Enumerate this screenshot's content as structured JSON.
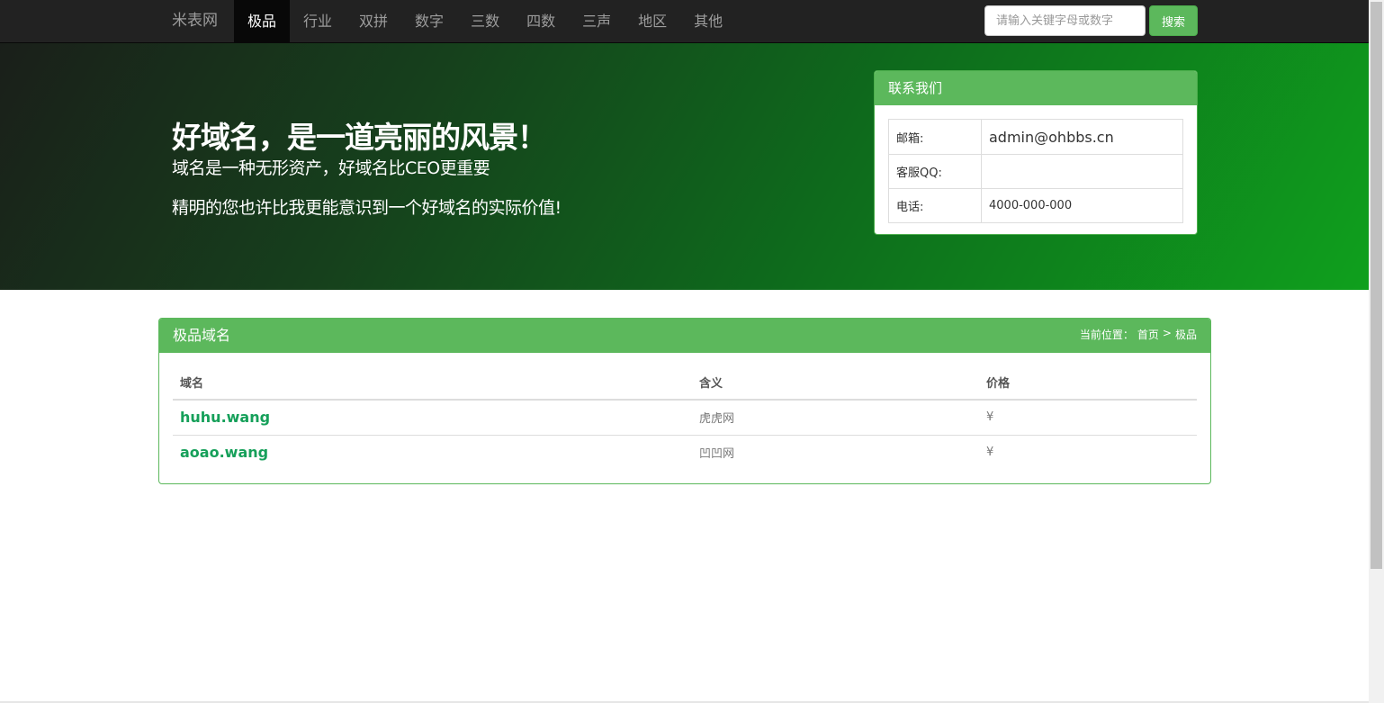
{
  "navbar": {
    "brand": "米表网",
    "items": [
      {
        "label": "极品",
        "active": true
      },
      {
        "label": "行业",
        "active": false
      },
      {
        "label": "双拼",
        "active": false
      },
      {
        "label": "数字",
        "active": false
      },
      {
        "label": "三数",
        "active": false
      },
      {
        "label": "四数",
        "active": false
      },
      {
        "label": "三声",
        "active": false
      },
      {
        "label": "地区",
        "active": false
      },
      {
        "label": "其他",
        "active": false
      }
    ],
    "search_placeholder": "请输入关键字母或数字",
    "search_value": "",
    "search_button": "搜索"
  },
  "hero": {
    "title": "好域名，是一道亮丽的风景！",
    "subtitle": "域名是一种无形资产，好域名比CEO更重要",
    "subtitle2": "精明的您也许比我更能意识到一个好域名的实际价值!"
  },
  "contact": {
    "title": "联系我们",
    "rows": [
      {
        "key": "邮箱:",
        "value": "admin@ohbbs.cn"
      },
      {
        "key": "客服QQ:",
        "value": ""
      },
      {
        "key": "电话:",
        "value": "4000-000-000"
      }
    ]
  },
  "domains": {
    "title": "极品域名",
    "breadcrumb": {
      "prefix": "当前位置：",
      "home": "首页",
      "sep": ">",
      "current": "极品"
    },
    "columns": [
      "域名",
      "含义",
      "价格"
    ],
    "rows": [
      {
        "domain": "huhu.wang",
        "meaning": "虎虎网",
        "price": "¥"
      },
      {
        "domain": "aoao.wang",
        "meaning": "凹凹网",
        "price": "¥"
      }
    ]
  },
  "colors": {
    "navbar": "#222222",
    "accent": "#5cb85c",
    "link": "#16a05a",
    "hero_end": "#0fa01d"
  }
}
